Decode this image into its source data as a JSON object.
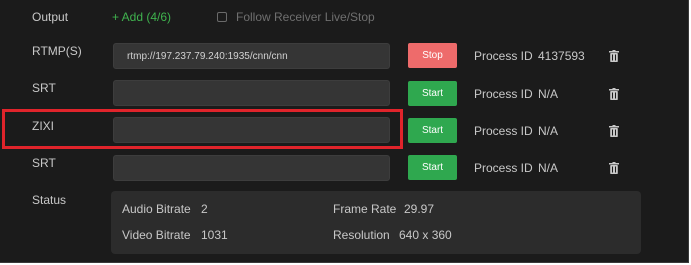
{
  "header": {
    "output_label": "Output",
    "add_label": "+ Add (4/6)",
    "follow_label": "Follow Receiver Live/Stop",
    "follow_checked": false
  },
  "rows": [
    {
      "protocol": "RTMP(S)",
      "url": "rtmp://197.237.79.240:1935/cnn/cnn",
      "button": "Stop",
      "pid_label": "Process ID",
      "pid": "4137593"
    },
    {
      "protocol": "SRT",
      "url": "",
      "button": "Start",
      "pid_label": "Process ID",
      "pid": "N/A"
    },
    {
      "protocol": "ZIXI",
      "url": "",
      "button": "Start",
      "pid_label": "Process ID",
      "pid": "N/A"
    },
    {
      "protocol": "SRT",
      "url": "",
      "button": "Start",
      "pid_label": "Process ID",
      "pid": "N/A"
    }
  ],
  "status": {
    "label": "Status",
    "audio_bitrate_label": "Audio Bitrate",
    "audio_bitrate": "2",
    "frame_rate_label": "Frame Rate",
    "frame_rate": "29.97",
    "video_bitrate_label": "Video Bitrate",
    "video_bitrate": "1031",
    "resolution_label": "Resolution",
    "resolution": "640 x 360"
  },
  "icons": {
    "delete": "trash-icon",
    "follow": "checkbox"
  },
  "colors": {
    "panel_bg": "#1b1b1b",
    "accent_green": "#3fb24e",
    "start_button": "#2fa84f",
    "stop_button": "#ee6b6b",
    "highlight": "#e0242b"
  }
}
